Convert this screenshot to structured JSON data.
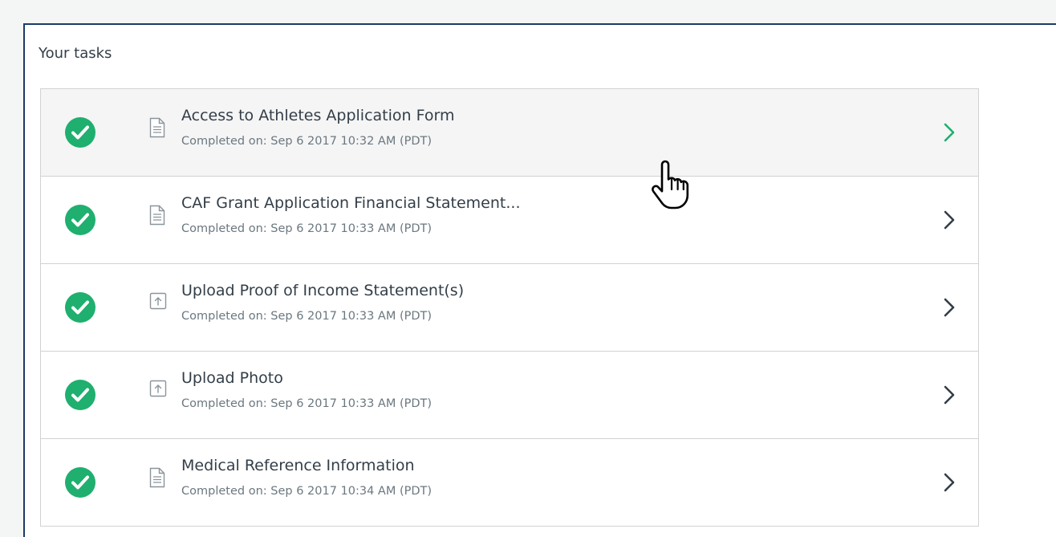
{
  "tasks_panel": {
    "title": "Your tasks",
    "tasks": [
      {
        "name": "Access to Athletes Application Form",
        "status": "Completed on: Sep 6 2017 10:32 AM (PDT)",
        "type_icon": "document-icon",
        "state_icon": "check-circle-icon",
        "hovered": true
      },
      {
        "name": "CAF Grant Application Financial Statement...",
        "status": "Completed on: Sep 6 2017 10:33 AM (PDT)",
        "type_icon": "document-icon",
        "state_icon": "check-circle-icon",
        "hovered": false
      },
      {
        "name": "Upload Proof of Income Statement(s)",
        "status": "Completed on: Sep 6 2017 10:33 AM (PDT)",
        "type_icon": "upload-icon",
        "state_icon": "check-circle-icon",
        "hovered": false
      },
      {
        "name": "Upload Photo",
        "status": "Completed on: Sep 6 2017 10:33 AM (PDT)",
        "type_icon": "upload-icon",
        "state_icon": "check-circle-icon",
        "hovered": false
      },
      {
        "name": "Medical Reference Information",
        "status": "Completed on: Sep 6 2017 10:34 AM (PDT)",
        "type_icon": "document-icon",
        "state_icon": "check-circle-icon",
        "hovered": false
      }
    ]
  },
  "colors": {
    "success_green": "#1faf6e",
    "border_navy": "#1b3a66",
    "chevron_dark": "#333e48",
    "chevron_hover": "#1faf6e"
  },
  "cursor": {
    "icon": "hand-pointer-icon"
  }
}
